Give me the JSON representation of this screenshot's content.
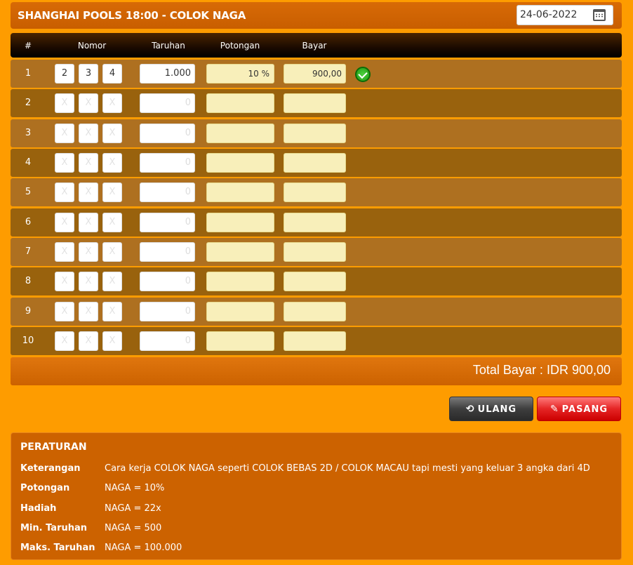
{
  "header": {
    "title": "SHANGHAI POOLS 18:00  -  COLOK NAGA",
    "date": "24-06-2022"
  },
  "table": {
    "columns": [
      "#",
      "Nomor",
      "Taruhan",
      "Potongan",
      "Bayar"
    ],
    "placeholder_digit": "X",
    "placeholder_bet": "0",
    "rows": [
      {
        "idx": "1",
        "digits": [
          "2",
          "3",
          "4"
        ],
        "bet": "1.000",
        "potongan": "10 %",
        "bayar": "900,00"
      },
      {
        "idx": "2"
      },
      {
        "idx": "3"
      },
      {
        "idx": "4"
      },
      {
        "idx": "5"
      },
      {
        "idx": "6"
      },
      {
        "idx": "7"
      },
      {
        "idx": "8"
      },
      {
        "idx": "9"
      },
      {
        "idx": "10"
      }
    ]
  },
  "total": {
    "label": "Total Bayar : IDR  900,00"
  },
  "buttons": {
    "ulang": "ULANG",
    "pasang": "PASANG"
  },
  "rules": {
    "title": "PERATURAN",
    "items": [
      {
        "label": "Keterangan",
        "value": "Cara kerja COLOK NAGA seperti COLOK BEBAS 2D / COLOK MACAU tapi mesti yang keluar 3 angka dari 4D"
      },
      {
        "label": "Potongan",
        "value": "NAGA = 10%"
      },
      {
        "label": "Hadiah",
        "value": "NAGA = 22x"
      },
      {
        "label": "Min. Taruhan",
        "value": "NAGA = 500"
      },
      {
        "label": "Maks. Taruhan",
        "value": "NAGA = 100.000"
      }
    ]
  },
  "colors": {
    "background": "#FE9C00",
    "header": "#CC6200",
    "row_odd": "#AE7020",
    "row_even": "#99620D",
    "readonly_field": "#F8EFBA",
    "pasang_button": "#E52525",
    "ulang_button": "#3E3E3E"
  },
  "icons": {
    "date": "calendar-icon",
    "row_status": "check-circle-icon",
    "ulang": "refresh-icon",
    "pasang": "edit-icon"
  }
}
